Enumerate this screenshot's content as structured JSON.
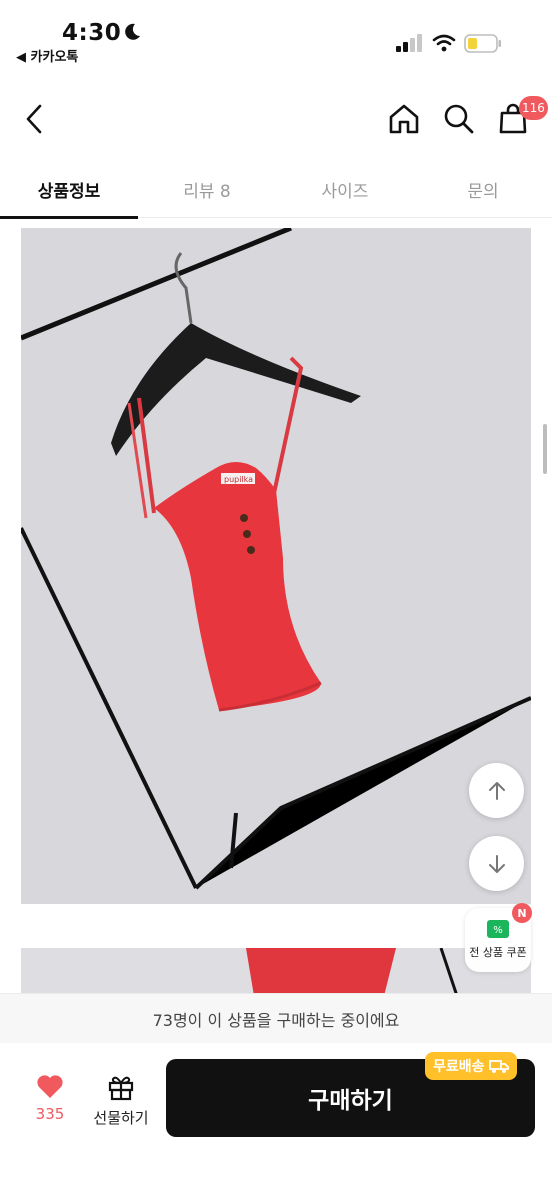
{
  "status_bar": {
    "time": "4:30",
    "back_app": "◀ 카카오톡"
  },
  "header": {
    "icons": [
      "chevron-left-icon",
      "home-icon",
      "search-icon",
      "shopping-bag-icon"
    ],
    "cart_count": "116"
  },
  "tabs": [
    {
      "label": "상품정보",
      "active": true
    },
    {
      "label": "리뷰 8",
      "active": false
    },
    {
      "label": "사이즈",
      "active": false
    },
    {
      "label": "문의",
      "active": false
    }
  ],
  "product": {
    "tag_text": "pupilka"
  },
  "floating": {
    "coupon_badge": "N",
    "coupon_label": "전 상품 쿠폰"
  },
  "notice": "73명이 이 상품을 구매하는 중이에요",
  "bottom": {
    "like_count": "335",
    "gift_label": "선물하기",
    "buy_label": "구매하기",
    "free_shipping_label": "무료배송"
  },
  "colors": {
    "accent_red": "#f05a5f",
    "free_shipping": "#ffc02a",
    "buy_button": "#111111"
  }
}
